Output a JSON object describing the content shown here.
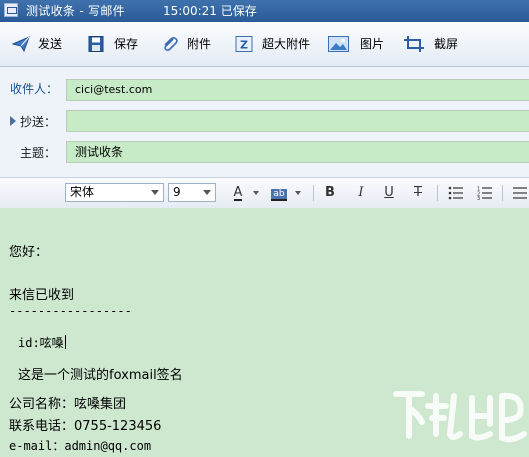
{
  "window": {
    "title": "测试收条 - 写邮件",
    "save_status": "15:00:21 已保存"
  },
  "toolbar": {
    "send": "发送",
    "save": "保存",
    "attach": "附件",
    "large_attach": "超大附件",
    "image": "图片",
    "screenshot": "截屏"
  },
  "header": {
    "to_label": "收件人：",
    "to_value": "cici@test.com",
    "cc_label": "抄送：",
    "cc_value": "",
    "subject_label": "主题：",
    "subject_value": "测试收条"
  },
  "format": {
    "font": "宋体",
    "size": "9",
    "font_color_glyph": "A",
    "highlight_glyph": "ab",
    "bold": "B",
    "italic": "I",
    "underline": "U",
    "strike": "T"
  },
  "body": {
    "greeting": "您好：",
    "line1": "来信已收到",
    "divider": "-----------------",
    "id_line": "id:呟嗓",
    "sig1": "这是一个测试的foxmail签名",
    "company": "公司名称：呟嗓集团",
    "phone": "联系电话：0755-123456",
    "email": "e-mail：admin@qq.com"
  },
  "colors": {
    "title_bar": "#2f62a0",
    "field_bg": "#c7ebc7",
    "editor_bg": "#cde8cf"
  }
}
